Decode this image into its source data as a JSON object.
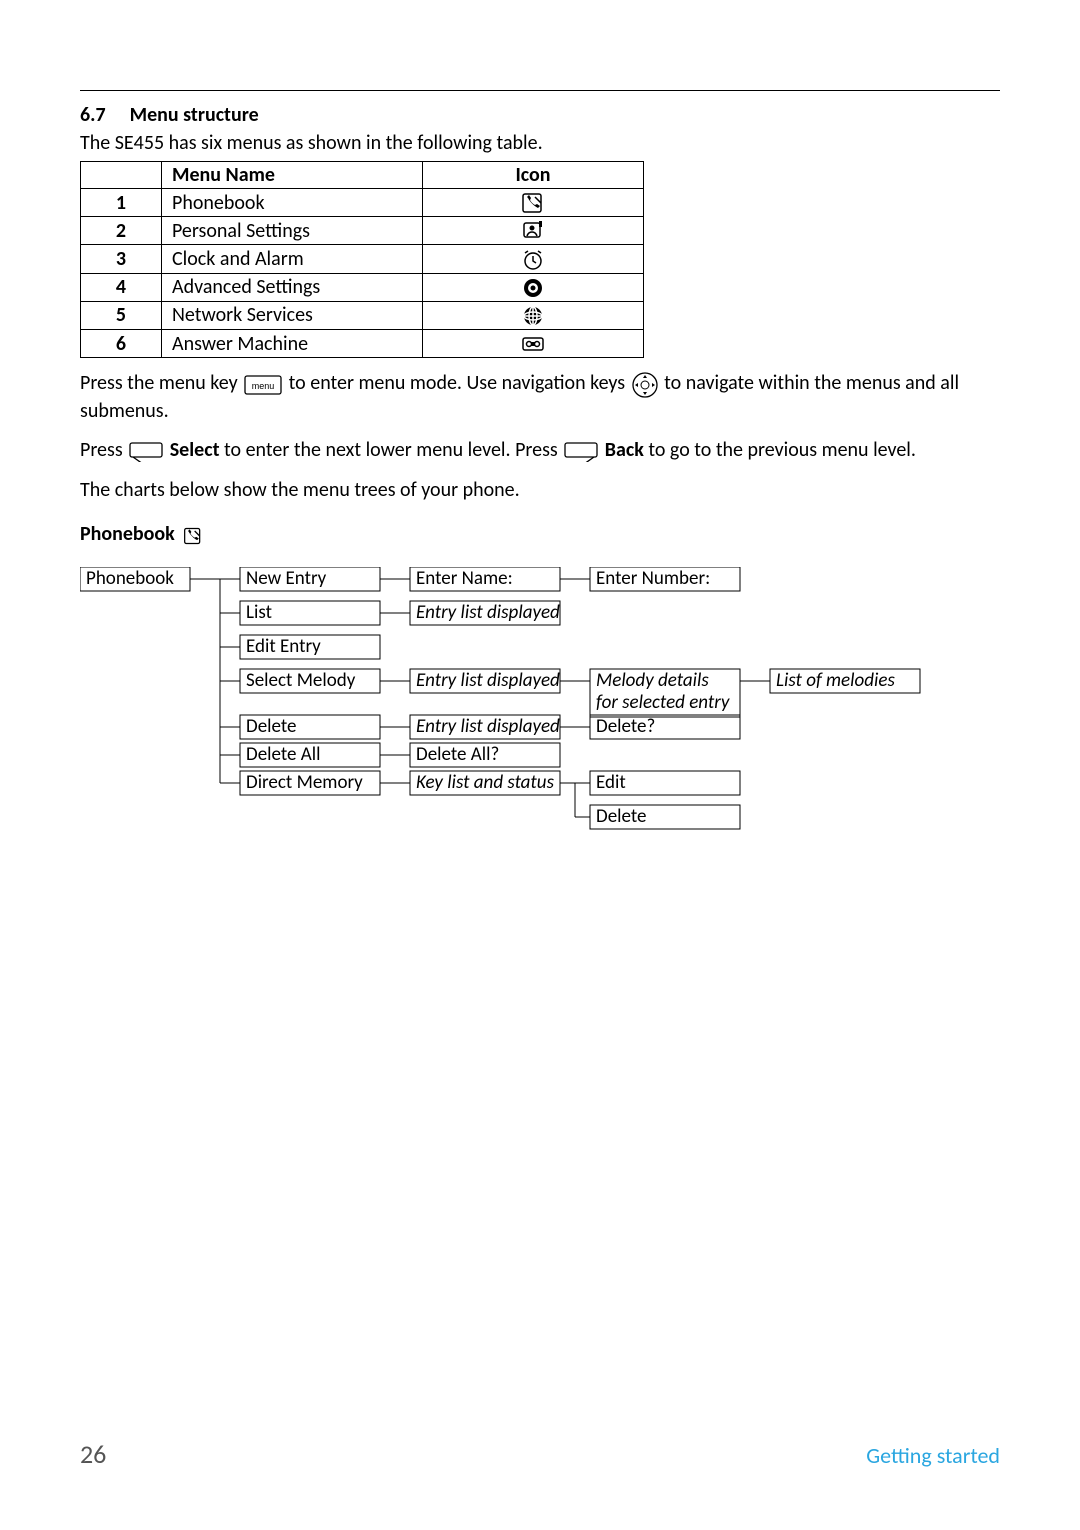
{
  "section": {
    "number": "6.7",
    "title": "Menu structure"
  },
  "intro": "The SE455 has six menus as shown in the following table.",
  "table": {
    "headers": {
      "name": "Menu Name",
      "icon": "Icon"
    },
    "rows": [
      {
        "n": "1",
        "name": "Phonebook",
        "iconName": "phonebook-icon"
      },
      {
        "n": "2",
        "name": "Personal Settings",
        "iconName": "personal-settings-icon"
      },
      {
        "n": "3",
        "name": "Clock and Alarm",
        "iconName": "clock-alarm-icon"
      },
      {
        "n": "4",
        "name": "Advanced Settings",
        "iconName": "advanced-settings-icon"
      },
      {
        "n": "5",
        "name": "Network Services",
        "iconName": "network-services-icon"
      },
      {
        "n": "6",
        "name": "Answer Machine",
        "iconName": "answer-machine-icon"
      }
    ]
  },
  "para1a": "Press the menu key ",
  "para1b": " to enter menu mode. Use navigation keys ",
  "para1c": " to navigate within the menus and all submenus.",
  "para2a": "Press ",
  "para2b": " ",
  "para2bold1": "Select",
  "para2c": " to enter the next lower menu level. Press ",
  "para2bold2": "Back",
  "para2d": " to go to the previous menu level.",
  "para3": "The charts below show the menu trees of your phone.",
  "subheading": "Phonebook",
  "tree": {
    "root": "Phonebook",
    "items": [
      {
        "l1": "New Entry",
        "l2": "Enter Name:",
        "l3": "Enter Number:"
      },
      {
        "l1": "List",
        "l2italic": "Entry list displayed"
      },
      {
        "l1": "Edit Entry"
      },
      {
        "l1": "Select Melody",
        "l2italic": "Entry list displayed",
        "l3italic": "Melody details",
        "l3bitalic": "for selected entry",
        "l4italic": "List of melodies"
      },
      {
        "l1": "Delete",
        "l2italic": "Entry list displayed",
        "l3": "Delete?"
      },
      {
        "l1": "Delete All",
        "l2": "Delete All?"
      },
      {
        "l1": "Direct Memory",
        "l2italic": "Key list and status",
        "l3": "Edit",
        "l3b": "Delete"
      }
    ]
  },
  "footer": {
    "page": "26",
    "section": "Getting started"
  }
}
